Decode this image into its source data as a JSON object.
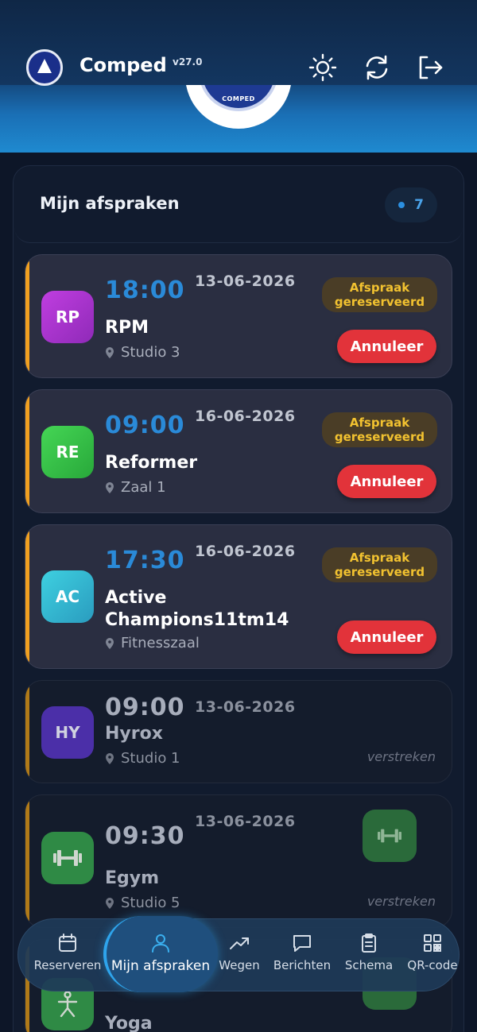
{
  "header": {
    "logo_text": "COMPED",
    "title": "Comped",
    "version": "v27.0",
    "icons": [
      "sun-icon",
      "refresh-icon",
      "logout-icon"
    ]
  },
  "panel": {
    "title": "Mijn afspraken",
    "count": "7"
  },
  "appointments": [
    {
      "initials": "RP",
      "time": "18:00",
      "date": "13-06-2026",
      "name": "RPM",
      "location": "Studio 3",
      "status": "Afspraak gereserveerd",
      "action": "Annuleer",
      "color": "#b23ad6"
    },
    {
      "initials": "RE",
      "time": "09:00",
      "date": "16-06-2026",
      "name": "Reformer",
      "location": "Zaal 1",
      "status": "Afspraak gereserveerd",
      "action": "Annuleer",
      "color": "#33c24a"
    },
    {
      "initials": "AC",
      "time": "17:30",
      "date": "16-06-2026",
      "name": "Active Champions11tm14",
      "location": "Fitnesszaal",
      "status": "Afspraak gereserveerd",
      "action": "Annuleer",
      "color": "#2cb8d0"
    },
    {
      "initials": "HY",
      "time": "09:00",
      "date": "13-06-2026",
      "name": "Hyrox",
      "location": "Studio 1",
      "status": "verstreken",
      "color": "#4b2fa8"
    },
    {
      "initials": "",
      "time": "09:30",
      "date": "13-06-2026",
      "name": "Egym",
      "location": "Studio 5",
      "status": "verstreken",
      "color": "#2f8a45"
    },
    {
      "initials": "",
      "time": "",
      "date": "",
      "name": "Yoga",
      "location": "",
      "status": "",
      "color": "#2f8a45"
    }
  ],
  "nav": {
    "items": [
      {
        "label": "Reserveren",
        "icon": "calendar-icon"
      },
      {
        "label": "Mijn afspraken",
        "icon": "user-icon"
      },
      {
        "label": "Wegen",
        "icon": "trend-icon"
      },
      {
        "label": "Berichten",
        "icon": "chat-icon"
      },
      {
        "label": "Schema",
        "icon": "clipboard-icon"
      },
      {
        "label": "QR-code",
        "icon": "qr-icon"
      }
    ],
    "active_index": 1,
    "accent": "#2ea4ec"
  },
  "colors": {
    "time": "#2a8ad8",
    "badge_text": "#f2c230",
    "cancel": "#e2333a",
    "accent_bar": "#f0a020"
  }
}
